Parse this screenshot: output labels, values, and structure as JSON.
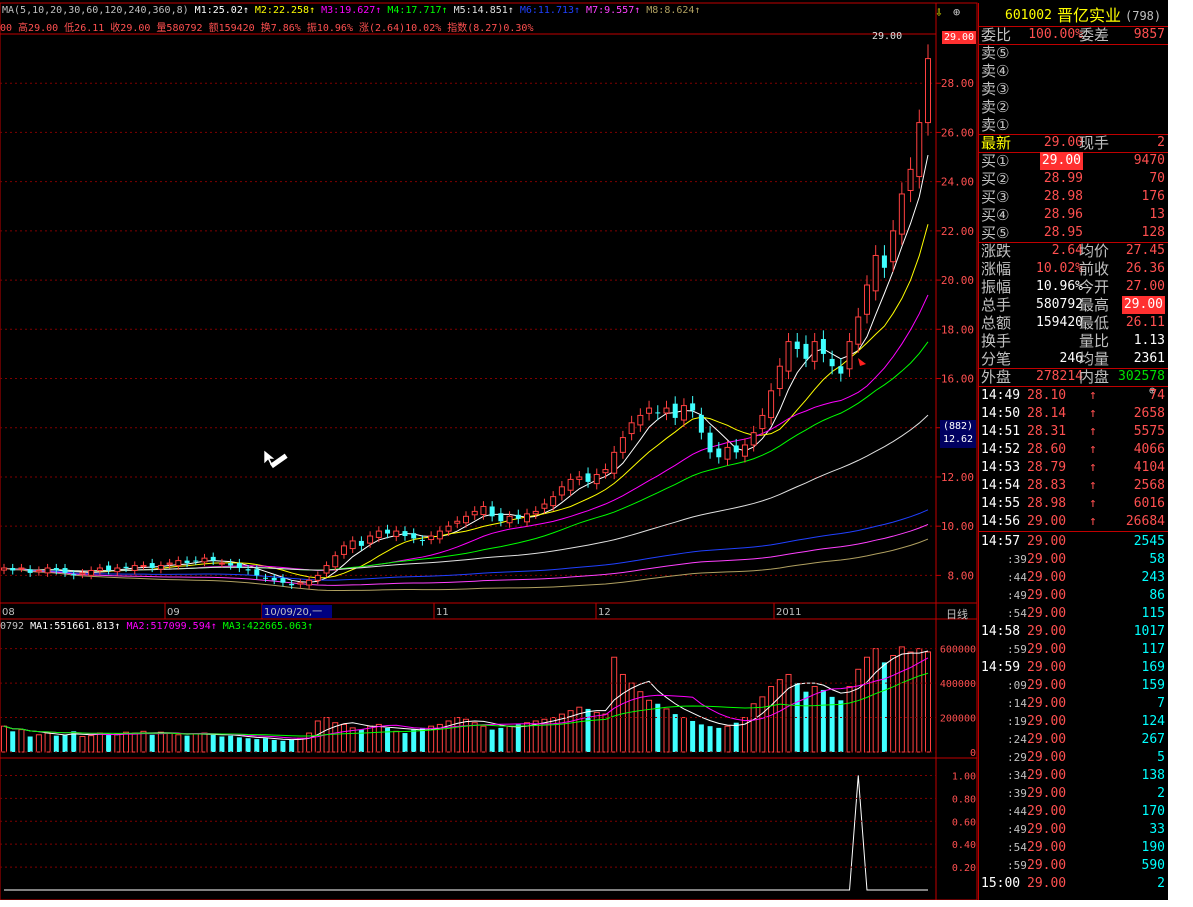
{
  "ma_legend": {
    "label": "MA(5,10,20,30,60,120,240,360,8)",
    "items": [
      {
        "text": "M1:25.02",
        "color": "#ffffff"
      },
      {
        "text": "M2:22.258",
        "color": "#ffff00"
      },
      {
        "text": "M3:19.627",
        "color": "#ff00ff"
      },
      {
        "text": "M4:17.717",
        "color": "#00ff00"
      },
      {
        "text": "M5:14.851",
        "color": "#e0e0e0"
      },
      {
        "text": "M6:11.713",
        "color": "#2040ff"
      },
      {
        "text": "M7:9.557",
        "color": "#ff40ff"
      },
      {
        "text": "M8:8.624",
        "color": "#b0a060"
      }
    ]
  },
  "quote_line": {
    "text": "00 高29.00 低26.11 收29.00 量580792 额159420 换7.86% 振10.96% 涨(2.64)10.02% 指数(8.27)0.30%"
  },
  "price_axis": [
    "28.00",
    "26.00",
    "24.00",
    "22.00",
    "20.00",
    "18.00",
    "16.00",
    "14.00",
    "12.00",
    "10.00",
    "8.00"
  ],
  "last_price_tag": "29.00",
  "high_label": "29.00",
  "cursor_box": {
    "top": "(882)",
    "bottom": "12.62"
  },
  "date_axis": [
    "08",
    "09",
    "10/09/20,一",
    "11",
    "12",
    "2011"
  ],
  "period_label": "日线",
  "volume_legend": {
    "prefix": "0792",
    "items": [
      {
        "text": "MA1:551661.813",
        "color": "#ffffff"
      },
      {
        "text": "MA2:517099.594",
        "color": "#ff00ff"
      },
      {
        "text": "MA3:422665.063",
        "color": "#00ff00"
      }
    ]
  },
  "volume_axis": [
    "600000",
    "400000",
    "200000",
    "0"
  ],
  "indicator_axis": [
    "1.00",
    "0.80",
    "0.60",
    "0.40",
    "0.20"
  ],
  "stock": {
    "code": "601002",
    "name": "晋亿实业",
    "extra": "(798)"
  },
  "order_ratio": {
    "label1": "委比",
    "value1": "100.00%",
    "label2": "委差",
    "value2": "9857"
  },
  "asks": [
    {
      "label": "卖⑤",
      "price": "",
      "vol": ""
    },
    {
      "label": "卖④",
      "price": "",
      "vol": ""
    },
    {
      "label": "卖③",
      "price": "",
      "vol": ""
    },
    {
      "label": "卖②",
      "price": "",
      "vol": ""
    },
    {
      "label": "卖①",
      "price": "",
      "vol": ""
    }
  ],
  "latest": {
    "label": "最新",
    "price": "29.00",
    "label2": "现手",
    "vol": "2"
  },
  "bids": [
    {
      "label": "买①",
      "price": "29.00",
      "vol": "9470"
    },
    {
      "label": "买②",
      "price": "28.99",
      "vol": "70"
    },
    {
      "label": "买③",
      "price": "28.98",
      "vol": "176"
    },
    {
      "label": "买④",
      "price": "28.96",
      "vol": "13"
    },
    {
      "label": "买⑤",
      "price": "28.95",
      "vol": "128"
    }
  ],
  "stats": [
    {
      "l1": "涨跌",
      "v1": "2.64",
      "l2": "均价",
      "v2": "27.45"
    },
    {
      "l1": "涨幅",
      "v1": "10.02%",
      "l2": "前收",
      "v2": "26.36"
    },
    {
      "l1": "振幅",
      "v1": "10.96%",
      "l2": "今开",
      "v2": "27.00"
    },
    {
      "l1": "总手",
      "v1": "580792",
      "l2": "最高",
      "v2": "29.00"
    },
    {
      "l1": "总额",
      "v1": "159420",
      "l2": "最低",
      "v2": "26.11"
    },
    {
      "l1": "换手",
      "v1": "",
      "l2": "量比",
      "v2": "1.13"
    },
    {
      "l1": "分笔",
      "v1": "246",
      "l2": "均量",
      "v2": "2361"
    }
  ],
  "outer_inner": {
    "l1": "外盘",
    "v1": "278214",
    "l2": "内盘",
    "v2": "302578"
  },
  "ticks_a": [
    {
      "time": "14:49",
      "price": "28.10",
      "arrow": "↑",
      "vol": "74"
    },
    {
      "time": "14:50",
      "price": "28.14",
      "arrow": "↑",
      "vol": "2658"
    },
    {
      "time": "14:51",
      "price": "28.31",
      "arrow": "↑",
      "vol": "5575"
    },
    {
      "time": "14:52",
      "price": "28.60",
      "arrow": "↑",
      "vol": "4066"
    },
    {
      "time": "14:53",
      "price": "28.79",
      "arrow": "↑",
      "vol": "4104"
    },
    {
      "time": "14:54",
      "price": "28.83",
      "arrow": "↑",
      "vol": "2568"
    },
    {
      "time": "14:55",
      "price": "28.98",
      "arrow": "↑",
      "vol": "6016"
    },
    {
      "time": "14:56",
      "price": "29.00",
      "arrow": "↑",
      "vol": "26684"
    }
  ],
  "ticks_b": [
    {
      "time": "14:57",
      "price": "29.00",
      "vol": "2545"
    },
    {
      "time": ":39",
      "price": "29.00",
      "vol": "58"
    },
    {
      "time": ":44",
      "price": "29.00",
      "vol": "243"
    },
    {
      "time": ":49",
      "price": "29.00",
      "vol": "86"
    },
    {
      "time": ":54",
      "price": "29.00",
      "vol": "115"
    },
    {
      "time": "14:58",
      "price": "29.00",
      "vol": "1017"
    },
    {
      "time": ":59",
      "price": "29.00",
      "vol": "117"
    },
    {
      "time": "14:59",
      "price": "29.00",
      "vol": "169"
    },
    {
      "time": ":09",
      "price": "29.00",
      "vol": "159"
    },
    {
      "time": ":14",
      "price": "29.00",
      "vol": "7"
    },
    {
      "time": ":19",
      "price": "29.00",
      "vol": "124"
    },
    {
      "time": ":24",
      "price": "29.00",
      "vol": "267"
    },
    {
      "time": ":29",
      "price": "29.00",
      "vol": "5"
    },
    {
      "time": ":34",
      "price": "29.00",
      "vol": "138"
    },
    {
      "time": ":39",
      "price": "29.00",
      "vol": "2"
    },
    {
      "time": ":44",
      "price": "29.00",
      "vol": "170"
    },
    {
      "time": ":49",
      "price": "29.00",
      "vol": "33"
    },
    {
      "time": ":54",
      "price": "29.00",
      "vol": "190"
    },
    {
      "time": ":59",
      "price": "29.00",
      "vol": "590"
    },
    {
      "time": "15:00",
      "price": "29.00",
      "vol": "2"
    }
  ],
  "chart_data": {
    "type": "candlestick",
    "price_ylim": [
      7,
      30
    ],
    "volume_ylim": [
      0,
      650000
    ],
    "indicator_ylim": [
      0,
      1.1
    ],
    "closes": [
      8.3,
      8.2,
      8.3,
      8.1,
      8.2,
      8.3,
      8.2,
      8.1,
      8.0,
      8.1,
      8.2,
      8.3,
      8.2,
      8.3,
      8.3,
      8.4,
      8.4,
      8.3,
      8.4,
      8.5,
      8.6,
      8.5,
      8.6,
      8.7,
      8.6,
      8.5,
      8.4,
      8.3,
      8.2,
      8.0,
      7.9,
      7.8,
      7.7,
      7.6,
      7.7,
      7.8,
      8.0,
      8.4,
      8.8,
      9.2,
      9.4,
      9.2,
      9.6,
      9.8,
      9.7,
      9.8,
      9.6,
      9.5,
      9.4,
      9.6,
      9.8,
      10.0,
      10.2,
      10.4,
      10.6,
      10.8,
      10.4,
      10.2,
      10.4,
      10.3,
      10.5,
      10.6,
      10.9,
      11.2,
      11.6,
      11.9,
      12.0,
      11.8,
      12.1,
      12.3,
      13.0,
      13.6,
      14.2,
      14.5,
      14.8,
      14.6,
      14.8,
      14.4,
      14.9,
      14.7,
      13.8,
      13.0,
      12.8,
      13.2,
      13.0,
      13.3,
      13.8,
      14.5,
      15.5,
      16.5,
      17.5,
      17.2,
      16.8,
      17.5,
      17.0,
      16.5,
      16.2,
      17.5,
      18.5,
      19.8,
      21.0,
      20.5,
      22.0,
      23.5,
      24.5,
      26.4,
      29.0
    ],
    "volume_closes": [
      150000,
      120000,
      130000,
      90000,
      100000,
      110000,
      95000,
      100000,
      120000,
      90000,
      95000,
      110000,
      100000,
      105000,
      115000,
      110000,
      120000,
      100000,
      115000,
      110000,
      100000,
      95000,
      105000,
      110000,
      100000,
      90000,
      95000,
      85000,
      80000,
      75000,
      80000,
      70000,
      65000,
      70000,
      80000,
      110000,
      180000,
      200000,
      170000,
      160000,
      140000,
      130000,
      150000,
      160000,
      140000,
      120000,
      110000,
      130000,
      140000,
      150000,
      160000,
      180000,
      200000,
      190000,
      170000,
      150000,
      130000,
      140000,
      150000,
      160000,
      170000,
      180000,
      190000,
      200000,
      220000,
      240000,
      260000,
      250000,
      230000,
      220000,
      550000,
      450000,
      400000,
      350000,
      300000,
      280000,
      250000,
      220000,
      200000,
      180000,
      160000,
      150000,
      140000,
      150000,
      170000,
      200000,
      280000,
      320000,
      380000,
      420000,
      450000,
      400000,
      350000,
      380000,
      360000,
      320000,
      300000,
      380000,
      480000,
      550000,
      600000,
      520000,
      560000,
      610000,
      580000,
      600000,
      580792
    ]
  }
}
